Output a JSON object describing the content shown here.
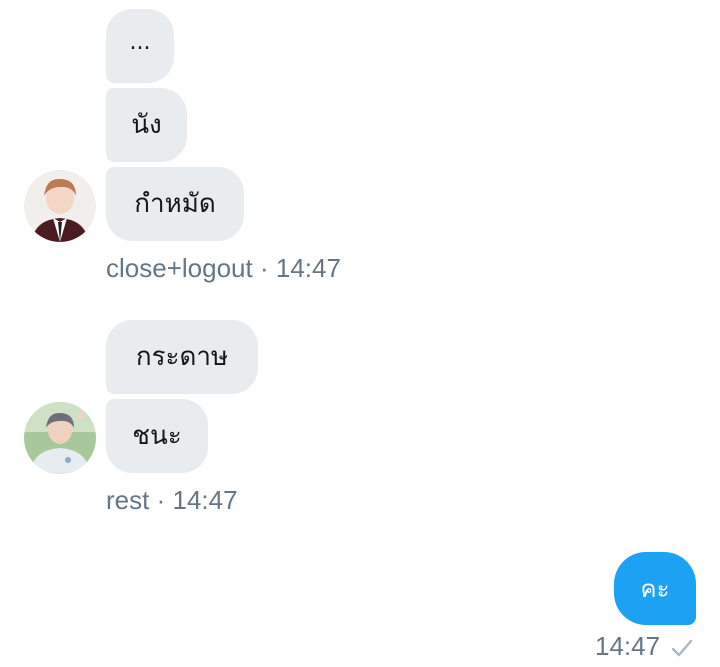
{
  "thread": {
    "groups": [
      {
        "sender": "close+logout",
        "time": "14:47",
        "messages": [
          "...",
          "นัง",
          "กำหมัด"
        ]
      },
      {
        "sender": "rest",
        "time": "14:47",
        "messages": [
          "กระดาษ",
          "ชนะ"
        ]
      }
    ],
    "separator": "·",
    "outgoing": {
      "text": "คะ",
      "time": "14:47"
    }
  },
  "icons": {
    "read_receipt": "check-icon"
  },
  "colors": {
    "incoming_bubble": "#e9ecef",
    "outgoing_bubble": "#1da1f2",
    "meta_text": "#657786",
    "check": "#aab8c2"
  }
}
